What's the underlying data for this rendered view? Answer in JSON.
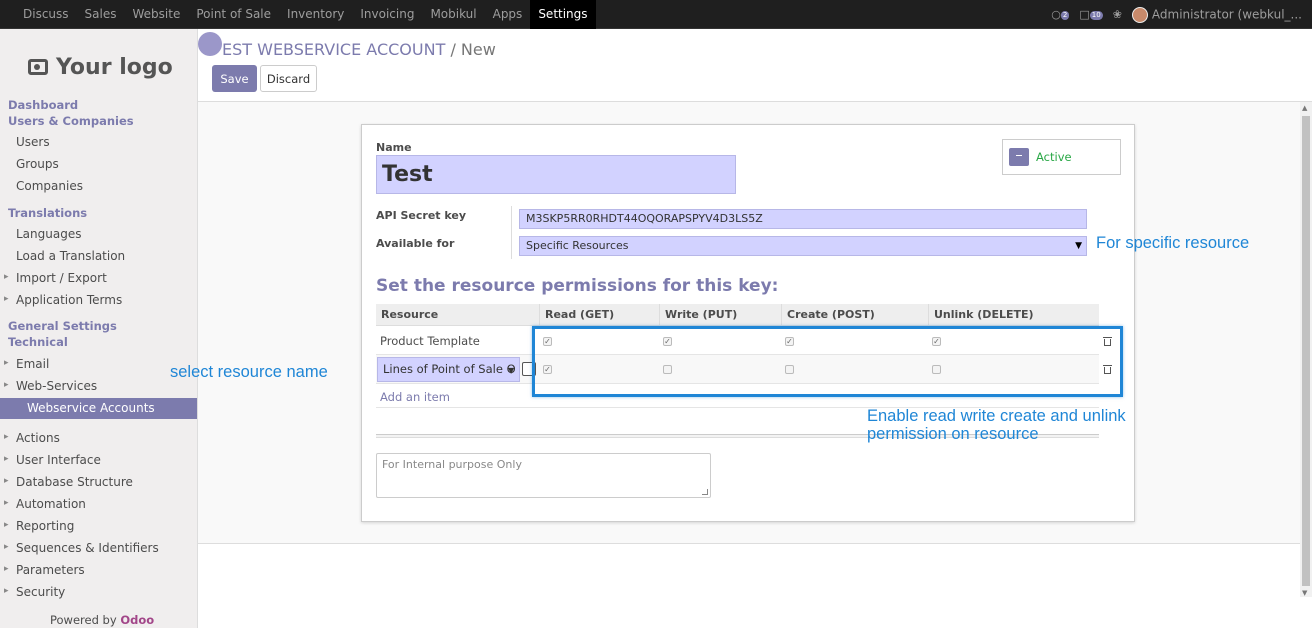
{
  "topnav": {
    "items": [
      "Discuss",
      "Sales",
      "Website",
      "Point of Sale",
      "Inventory",
      "Invoicing",
      "Mobikul",
      "Apps",
      "Settings"
    ],
    "active": "Settings",
    "chat_badge": "2",
    "msg_badge": "10",
    "user": "Administrator (webkul_..."
  },
  "sidebar": {
    "logo": "Your logo",
    "dashboard": "Dashboard",
    "users_companies": "Users & Companies",
    "users": "Users",
    "groups": "Groups",
    "companies": "Companies",
    "translations": "Translations",
    "languages": "Languages",
    "load_translation": "Load a Translation",
    "import_export": "Import / Export",
    "application_terms": "Application Terms",
    "general_settings": "General Settings",
    "technical": "Technical",
    "email": "Email",
    "web_services": "Web-Services",
    "webservice_accounts": "Webservice Accounts",
    "actions": "Actions",
    "user_interface": "User Interface",
    "database_structure": "Database Structure",
    "automation": "Automation",
    "reporting": "Reporting",
    "sequences": "Sequences & Identifiers",
    "parameters": "Parameters",
    "security": "Security",
    "powered_by": "Powered by",
    "odoo": "Odoo"
  },
  "control": {
    "breadcrumb_parent": "EST WEBSERVICE ACCOUNT",
    "breadcrumb_sep": "/",
    "breadcrumb_current": "New",
    "save": "Save",
    "discard": "Discard"
  },
  "form": {
    "name_label": "Name",
    "name_value": "Test",
    "active_label": "Active",
    "api_key_label": "API Secret key",
    "api_key_value": "M3SKP5RR0RHDT44OQORAPSPYV4D3LS5Z",
    "available_label": "Available for",
    "available_value": "Specific Resources",
    "perm_title": "Set the resource permissions for this key:",
    "columns": [
      "Resource",
      "Read (GET)",
      "Write (PUT)",
      "Create (POST)",
      "Unlink (DELETE)"
    ],
    "rows": [
      {
        "resource": "Product Template",
        "read": true,
        "write": true,
        "create": true,
        "unlink": true
      },
      {
        "resource": "Lines of Point of Sale O",
        "read": true,
        "write": false,
        "create": false,
        "unlink": false
      }
    ],
    "add_item": "Add an item",
    "note_placeholder": "For Internal purpose Only"
  },
  "annotations": {
    "specific": "For specific resource",
    "select_name": "select resource name",
    "enable_line1": "Enable read write create and unlink",
    "enable_line2": "permission on resource"
  }
}
